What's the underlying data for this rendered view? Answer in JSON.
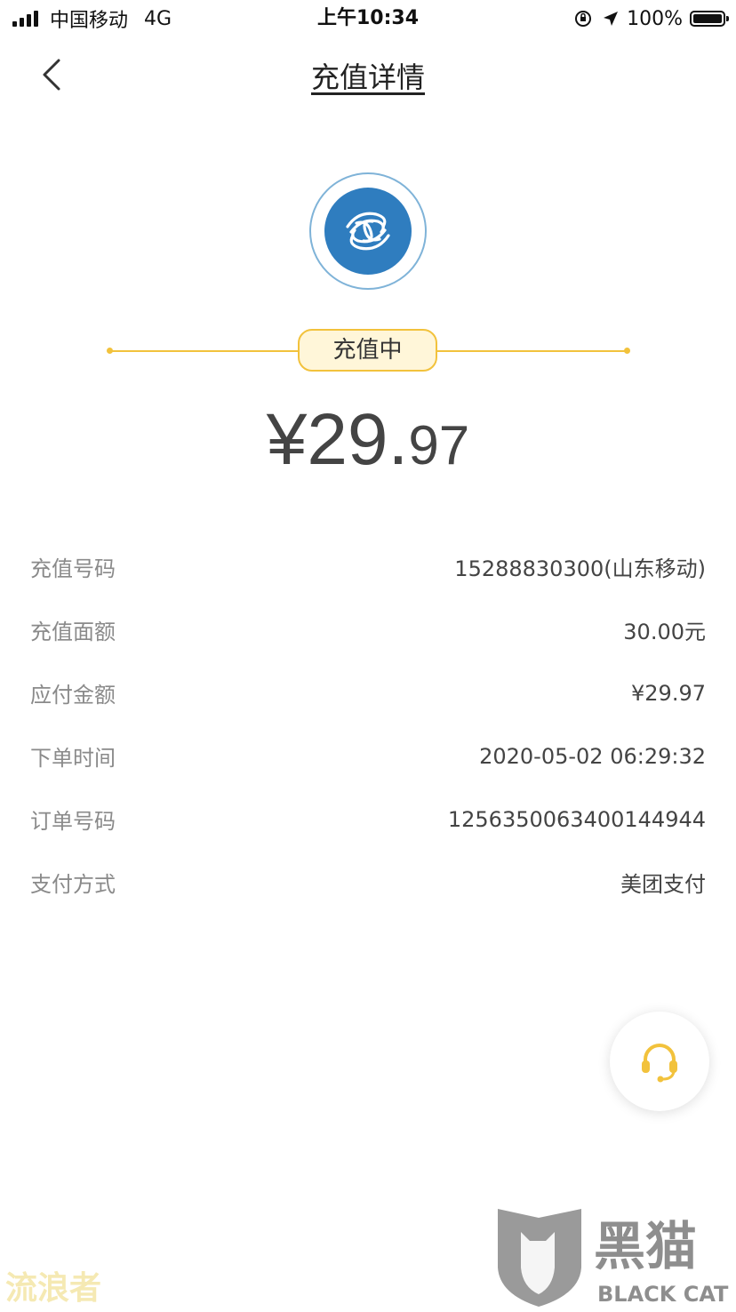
{
  "status_bar": {
    "carrier": "中国移动",
    "network": "4G",
    "time": "上午10:34",
    "battery": "100%",
    "battery_level": 1.0
  },
  "nav": {
    "title": "充值详情",
    "back_icon": "chevron-left-icon"
  },
  "logo": {
    "icon": "china-mobile-logo-icon",
    "brand_color": "#2f7dbf"
  },
  "status": {
    "label": "充值中",
    "accent_color": "#f2c23c"
  },
  "amount": {
    "currency": "¥",
    "integer": "29.",
    "decimal": "97"
  },
  "details": [
    {
      "label": "充值号码",
      "value": "15288830300(山东移动)"
    },
    {
      "label": "充值面额",
      "value": "30.00元"
    },
    {
      "label": "应付金额",
      "value": "¥29.97"
    },
    {
      "label": "下单时间",
      "value": "2020-05-02 06:29:32"
    },
    {
      "label": "订单号码",
      "value": "1256350063400144944"
    },
    {
      "label": "支付方式",
      "value": "美团支付"
    }
  ],
  "service_button": {
    "icon": "headset-icon",
    "color": "#f2c23c"
  },
  "watermarks": {
    "left_text": "流浪者",
    "right_brand": "黑猫",
    "right_brand_en": "BLACK CAT"
  }
}
